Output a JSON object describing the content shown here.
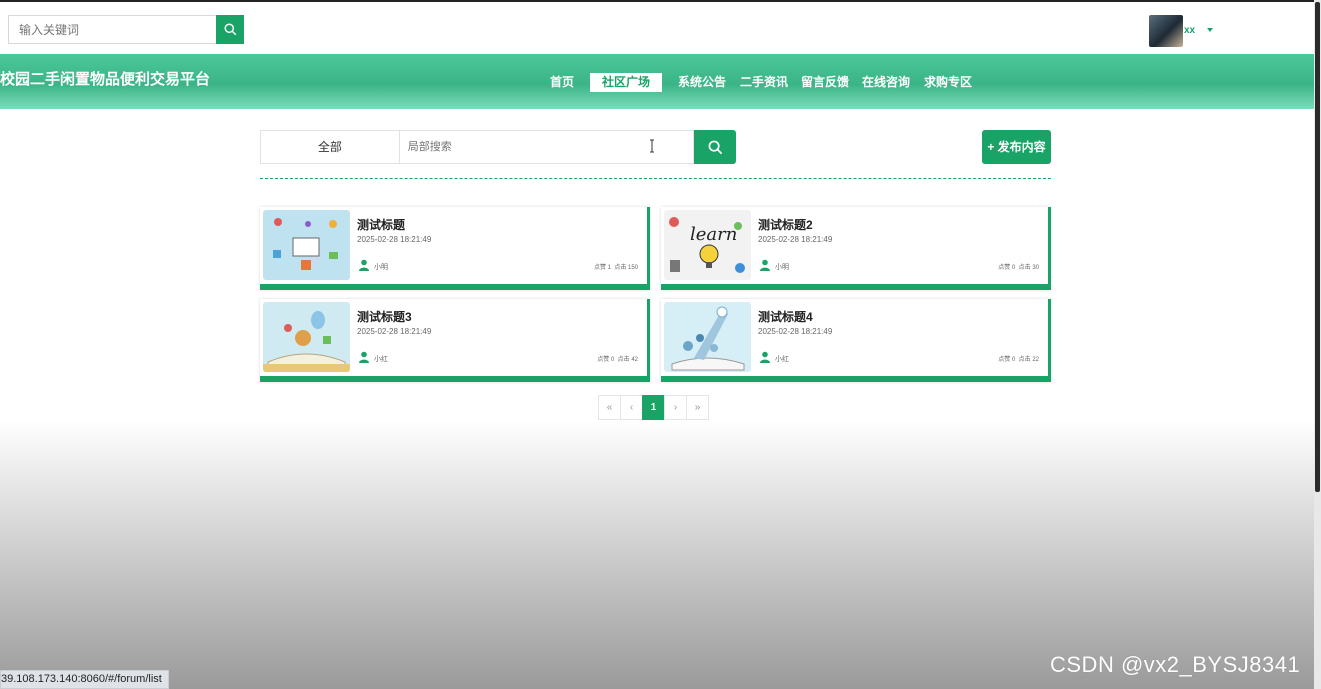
{
  "header": {
    "search_placeholder": "输入关键词",
    "username": "xx"
  },
  "nav": {
    "site_title": "校园二手闲置物品便利交易平台",
    "items": [
      {
        "label": "首页",
        "active": false
      },
      {
        "label": "社区广场",
        "active": true
      },
      {
        "label": "系统公告",
        "active": false
      },
      {
        "label": "二手资讯",
        "active": false
      },
      {
        "label": "留言反馈",
        "active": false
      },
      {
        "label": "在线咨询",
        "active": false
      },
      {
        "label": "求购专区",
        "active": false
      }
    ]
  },
  "filter": {
    "category": "全部",
    "placeholder": "局部搜索",
    "publish_label": "+ 发布内容"
  },
  "posts": [
    {
      "title": "测试标题",
      "date": "2025-02-28 18:21:49",
      "author": "小明",
      "likes": "点赞 1",
      "clicks": "点击 150"
    },
    {
      "title": "测试标题2",
      "date": "2025-02-28 18:21:49",
      "author": "小明",
      "likes": "点赞 0",
      "clicks": "点击 30"
    },
    {
      "title": "测试标题3",
      "date": "2025-02-28 18:21:49",
      "author": "小红",
      "likes": "点赞 0",
      "clicks": "点击 42"
    },
    {
      "title": "测试标题4",
      "date": "2025-02-28 18:21:49",
      "author": "小红",
      "likes": "点赞 0",
      "clicks": "点击 22"
    }
  ],
  "pagination": {
    "first": "«",
    "prev": "‹",
    "current": "1",
    "next": "›",
    "last": "»"
  },
  "status_url": "39.108.173.140:8060/#/forum/list",
  "watermark": "CSDN @vx2_BYSJ8341",
  "colors": {
    "accent": "#1aa366"
  }
}
